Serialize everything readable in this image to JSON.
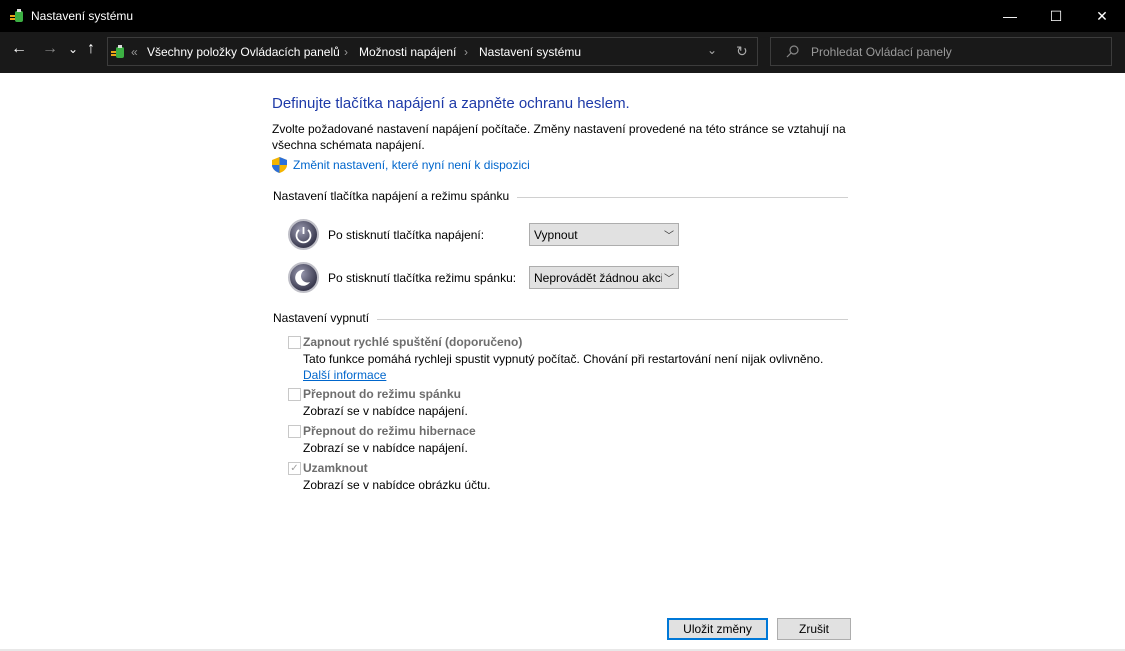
{
  "window": {
    "title": "Nastavení systému",
    "minimize": "—",
    "maximize": "☐",
    "close": "✕"
  },
  "nav": {
    "back": "←",
    "forward": "→",
    "recent": "⌄",
    "up": "↑",
    "overflow": "«",
    "breadcrumb": [
      "Všechny položky Ovládacích panelů",
      "Možnosti napájení",
      "Nastavení systému"
    ],
    "separator": "›",
    "dropdown": "⌄",
    "refresh": "↻",
    "search_placeholder": "Prohledat Ovládací panely"
  },
  "page": {
    "heading": "Definujte tlačítka napájení a zapněte ochranu heslem.",
    "description": "Zvolte požadované nastavení napájení počítače. Změny nastavení provedené na této stránce se vztahují na všechna schémata napájení.",
    "admin_link": "Změnit nastavení, které nyní není k dispozici",
    "section_buttons": "Nastavení tlačítka napájení a režimu spánku",
    "power_button_label": "Po stisknutí tlačítka napájení:",
    "power_button_value": "Vypnout",
    "sleep_button_label": "Po stisknutí tlačítka režimu spánku:",
    "sleep_button_value": "Neprovádět žádnou akci",
    "section_shutdown": "Nastavení vypnutí",
    "options": [
      {
        "label": "Zapnout rychlé spuštění (doporučeno)",
        "desc": "Tato funkce pomáhá rychleji spustit vypnutý počítač. Chování při restartování není nijak ovlivněno.",
        "link": "Další informace",
        "checked": false
      },
      {
        "label": "Přepnout do režimu spánku",
        "desc": "Zobrazí se v nabídce napájení.",
        "checked": false
      },
      {
        "label": "Přepnout do režimu hibernace",
        "desc": "Zobrazí se v nabídce napájení.",
        "checked": false
      },
      {
        "label": "Uzamknout",
        "desc": "Zobrazí se v nabídce obrázku účtu.",
        "checked": true
      }
    ]
  },
  "footer": {
    "save": "Uložit změny",
    "cancel": "Zrušit"
  },
  "colors": {
    "heading": "#1e3aa8",
    "link": "#0066cc",
    "titlebar": "#000000",
    "navbar": "#191919"
  }
}
